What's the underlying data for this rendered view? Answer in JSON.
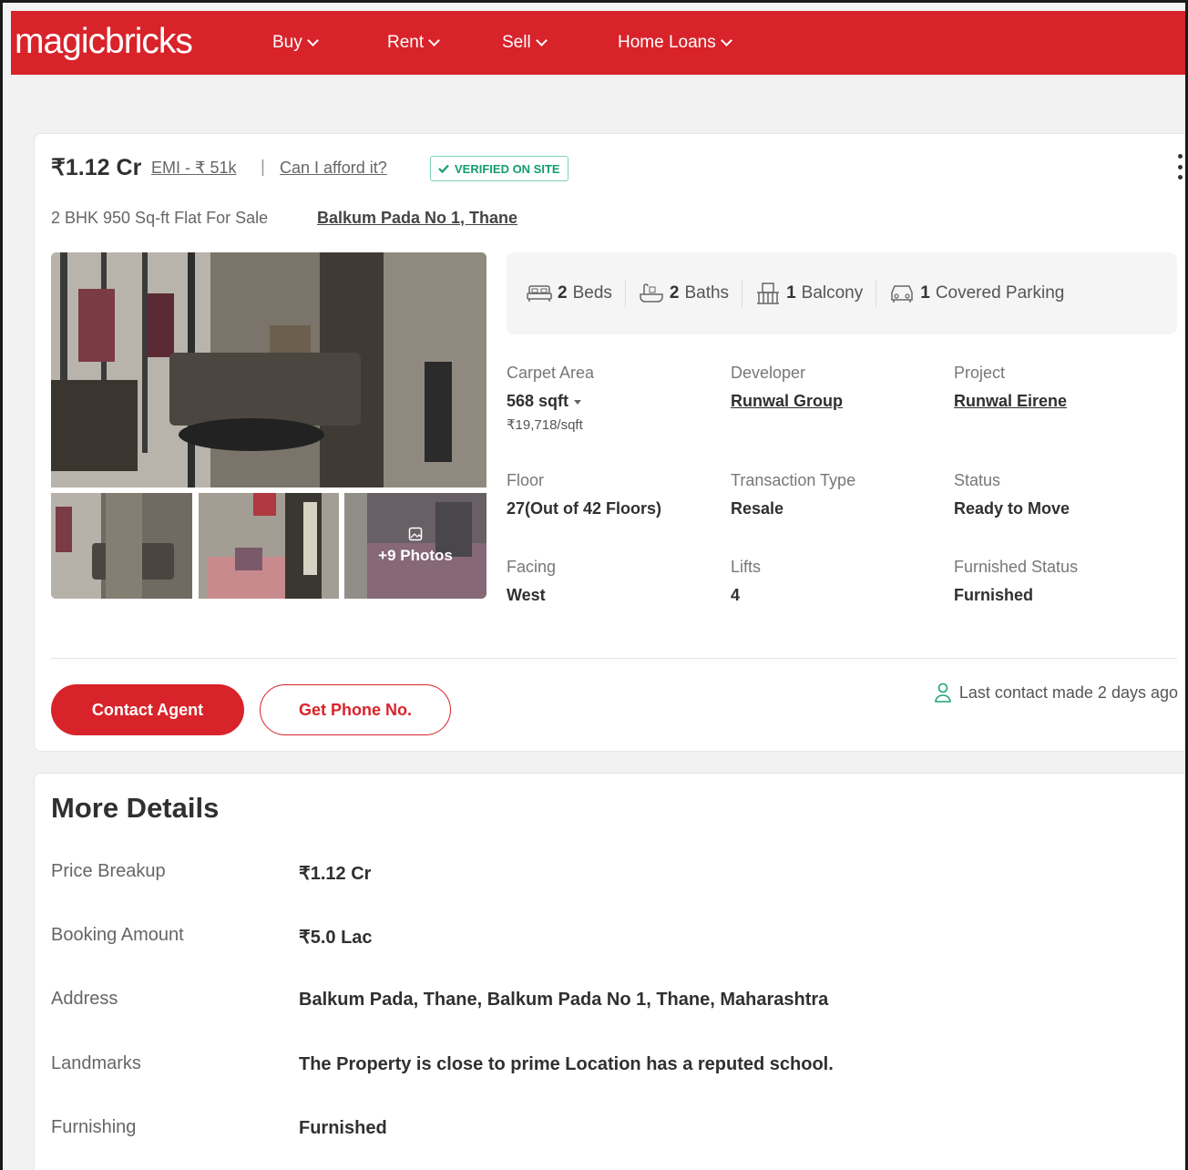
{
  "header": {
    "logo": "magicbricks",
    "nav": [
      {
        "label": "Buy"
      },
      {
        "label": "Rent"
      },
      {
        "label": "Sell"
      },
      {
        "label": "Home Loans"
      }
    ]
  },
  "listing": {
    "price": "₹1.12 Cr",
    "emi": "EMI - ₹ 51k",
    "separator": "|",
    "afford": "Can I afford it?",
    "verified": "VERIFIED ON SITE",
    "subtitle": "2 BHK 950 Sq-ft Flat For Sale",
    "locality": "Balkum Pada No 1, Thane",
    "more_photos": "+9 Photos",
    "amenities": [
      {
        "count": "2",
        "label": "Beds",
        "icon": "bed-icon"
      },
      {
        "count": "2",
        "label": "Baths",
        "icon": "bath-icon"
      },
      {
        "count": "1",
        "label": "Balcony",
        "icon": "balcony-icon"
      },
      {
        "count": "1",
        "label": "Covered Parking",
        "icon": "car-icon"
      }
    ],
    "specs": {
      "carpet_area": {
        "label": "Carpet Area",
        "value": "568 sqft",
        "sub": "₹19,718/sqft"
      },
      "developer": {
        "label": "Developer",
        "value": "Runwal Group"
      },
      "project": {
        "label": "Project",
        "value": "Runwal Eirene"
      },
      "floor": {
        "label": "Floor",
        "value": "27(Out of 42 Floors)"
      },
      "transaction": {
        "label": "Transaction Type",
        "value": "Resale"
      },
      "status": {
        "label": "Status",
        "value": "Ready to Move"
      },
      "facing": {
        "label": "Facing",
        "value": "West"
      },
      "lifts": {
        "label": "Lifts",
        "value": "4"
      },
      "furnished_status": {
        "label": "Furnished Status",
        "value": "Furnished"
      }
    },
    "contact_button": "Contact Agent",
    "phone_button": "Get Phone No.",
    "last_contact": "Last contact made 2 days ago"
  },
  "more_details": {
    "title": "More Details",
    "rows": [
      {
        "key": "Price Breakup",
        "value": "₹1.12 Cr"
      },
      {
        "key": "Booking Amount",
        "value": "₹5.0 Lac"
      },
      {
        "key": "Address",
        "value": "Balkum Pada, Thane, Balkum Pada No 1, Thane, Maharashtra"
      },
      {
        "key": "Landmarks",
        "value": "The Property is close to prime Location has a reputed school."
      },
      {
        "key": "Furnishing",
        "value": "Furnished"
      }
    ]
  },
  "colors": {
    "brand": "#d8232a",
    "verified": "#139e6c"
  }
}
